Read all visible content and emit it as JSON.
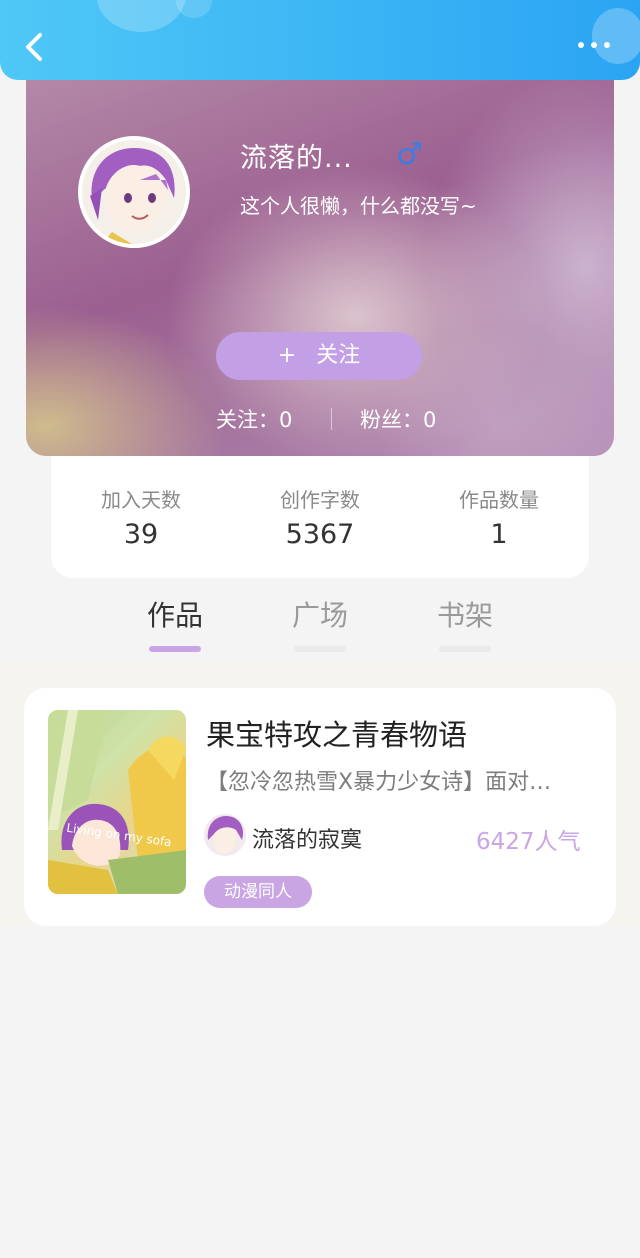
{
  "header": {
    "back_icon": "chevron-left-icon",
    "more_icon": "more-horizontal-icon"
  },
  "profile": {
    "username": "流落的...",
    "gender_symbol": "♂",
    "gender_color": "#3b7de0",
    "bio": "这个人很懒，什么都没写~",
    "follow_plus": "+",
    "follow_label": "关注",
    "following_text": "关注：0",
    "fans_text": "粉丝：0"
  },
  "stats": [
    {
      "label": "加入天数",
      "value": "39"
    },
    {
      "label": "创作字数",
      "value": "5367"
    },
    {
      "label": "作品数量",
      "value": "1"
    }
  ],
  "tabs": [
    {
      "label": "作品",
      "active": true
    },
    {
      "label": "广场",
      "active": false
    },
    {
      "label": "书架",
      "active": false
    }
  ],
  "book": {
    "title": "果宝特攻之青春物语",
    "description": "【忽冷忽热雪X暴力少女诗】面对…",
    "cover_caption": "Living on my sofa",
    "author": "流落的寂寞",
    "popularity": "6427人气",
    "tag": "动漫同人"
  },
  "colors": {
    "header_start": "#4fc8f6",
    "header_end": "#2ba4f3",
    "accent_purple": "#c39fe6",
    "popularity": "#c9a5e4"
  }
}
